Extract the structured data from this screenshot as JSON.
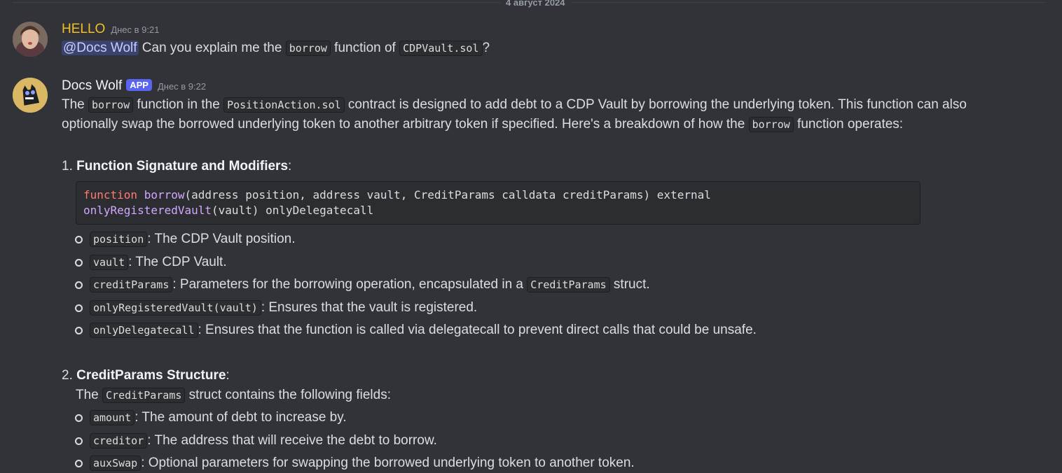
{
  "date_divider": "4 август 2024",
  "msg1": {
    "username": "HELLO",
    "timestamp": "Днес в 9:21",
    "mention": "@Docs Wolf",
    "text_before": " Can you explain me the ",
    "code1": "borrow",
    "text_middle": " function of ",
    "code2": "CDPVault.sol",
    "text_after": "?"
  },
  "msg2": {
    "username": "Docs Wolf",
    "badge": "APP",
    "timestamp": "Днес в 9:22",
    "p1": {
      "t1": "The ",
      "c1": "borrow",
      "t2": " function in the ",
      "c2": "PositionAction.sol",
      "t3": " contract is designed to add debt to a CDP Vault by borrowing the underlying token. This function can also"
    },
    "p2": {
      "t1": "optionally swap the borrowed underlying token to another arbitrary token if specified. Here's a breakdown of how the ",
      "c1": "borrow",
      "t2": " function operates:"
    },
    "section1": {
      "number": "1. ",
      "title": "Function Signature and Modifiers",
      "colon": ":",
      "code": {
        "kw": "function",
        "fn": "borrow",
        "rest1": "(address position, address vault, CreditParams calldata creditParams) external",
        "fn2": "onlyRegisteredVault",
        "rest2": "(vault) onlyDelegatecall"
      },
      "bullets": [
        {
          "code": "position",
          "text": ": The CDP Vault position."
        },
        {
          "code": "vault",
          "text": ": The CDP Vault."
        },
        {
          "code": "creditParams",
          "text": ": Parameters for the borrowing operation, encapsulated in a ",
          "code2": "CreditParams",
          "text2": " struct."
        },
        {
          "code": "onlyRegisteredVault(vault)",
          "text": ": Ensures that the vault is registered."
        },
        {
          "code": "onlyDelegatecall",
          "text": ": Ensures that the function is called via delegatecall to prevent direct calls that could be unsafe."
        }
      ]
    },
    "section2": {
      "number": "2. ",
      "title": "CreditParams Structure",
      "colon": ":",
      "intro_t1": "The ",
      "intro_c1": "CreditParams",
      "intro_t2": " struct contains the following fields:",
      "bullets": [
        {
          "code": "amount",
          "text": ": The amount of debt to increase by."
        },
        {
          "code": "creditor",
          "text": ": The address that will receive the debt to borrow."
        },
        {
          "code": "auxSwap",
          "text": ": Optional parameters for swapping the borrowed underlying token to another token."
        }
      ]
    }
  }
}
